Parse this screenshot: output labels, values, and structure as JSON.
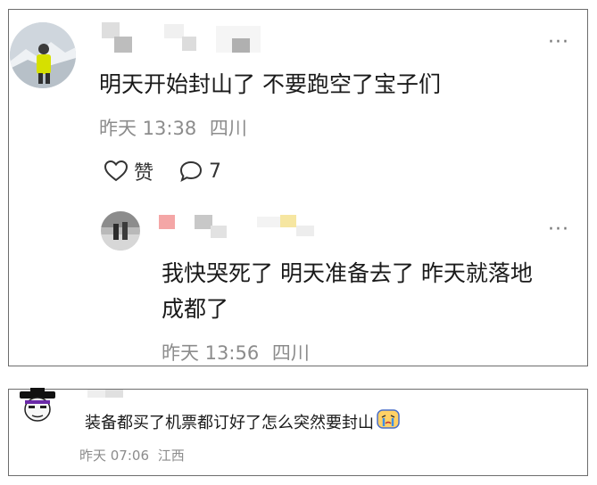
{
  "comment": {
    "text": "明天开始封山了 不要跑空了宝子们",
    "time": "昨天 13:38",
    "location": "四川",
    "like_label": "赞",
    "reply_count": "7",
    "more": "···"
  },
  "reply": {
    "text_line1": "我快哭死了 明天准备去了 昨天就落地",
    "text_line2": "成都了",
    "time": "昨天 13:56",
    "location": "四川",
    "more": "···"
  },
  "comment2": {
    "text": "装备都买了机票都订好了怎么突然要封山",
    "time": "昨天 07:06",
    "location": "江西"
  },
  "icons": {
    "like": "heart-outline-icon",
    "reply": "speech-bubble-icon",
    "more": "ellipsis-icon",
    "emoji": "crying-emoji-icon"
  },
  "colors": {
    "text": "#1a1a1a",
    "meta": "#8c8c8c",
    "border": "#6d6d6d"
  }
}
